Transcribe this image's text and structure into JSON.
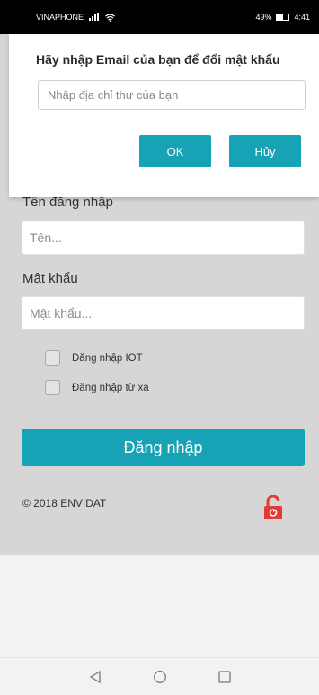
{
  "status_bar": {
    "carrier": "VINAPHONE",
    "battery": "49%",
    "time": "4:41"
  },
  "login": {
    "username_label": "Tên đăng nhập",
    "username_placeholder": "Tên...",
    "password_label": "Mật khẩu",
    "password_placeholder": "Mật khẩu...",
    "checkboxes": [
      {
        "label": "Đăng nhập IOT",
        "checked": false
      },
      {
        "label": "Đăng nhập từ xa",
        "checked": false
      }
    ],
    "login_button": "Đăng nhập",
    "copyright": "© 2018 ENVIDAT"
  },
  "dialog": {
    "title": "Hãy nhập Email của bạn để đổi mật khẩu",
    "email_placeholder": "Nhập địa chỉ thư của bạn",
    "ok_label": "OK",
    "cancel_label": "Hủy"
  },
  "icons": {
    "lock": "unlock-icon",
    "nav_back": "back-triangle-icon",
    "nav_home": "home-circle-icon",
    "nav_recent": "recent-square-icon"
  },
  "colors": {
    "accent": "#17a3b5",
    "lock": "#e53935"
  }
}
